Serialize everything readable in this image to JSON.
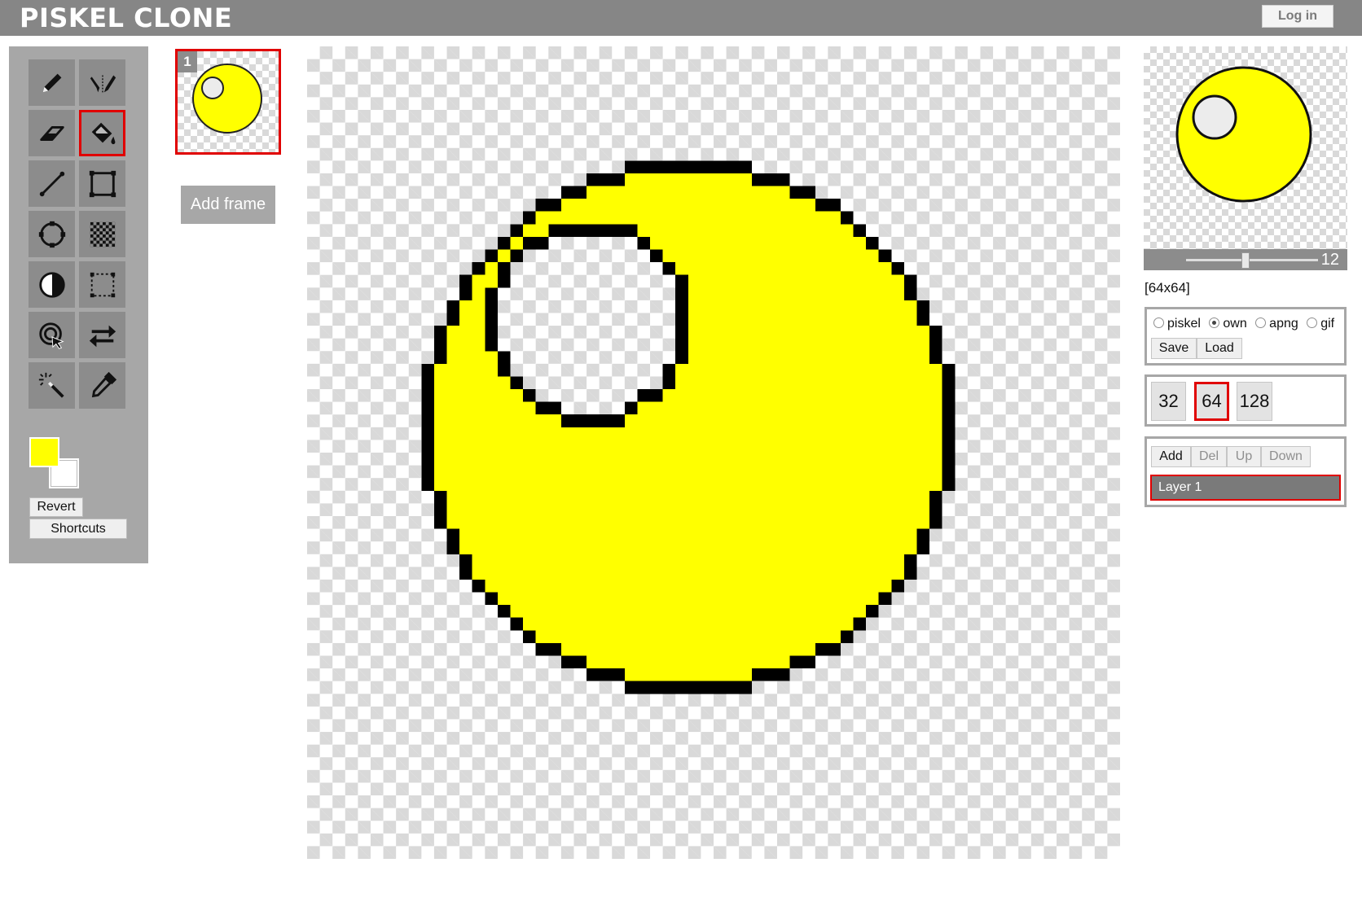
{
  "app": {
    "title": "PISKEL CLONE",
    "login_label": "Log in"
  },
  "tools": [
    {
      "name": "pen-tool",
      "icon": "pencil-icon",
      "selected": false
    },
    {
      "name": "mirror-pen-tool",
      "icon": "mirror-pen-icon",
      "selected": false
    },
    {
      "name": "eraser-tool",
      "icon": "eraser-icon",
      "selected": false
    },
    {
      "name": "paint-bucket-tool",
      "icon": "paint-bucket-icon",
      "selected": true
    },
    {
      "name": "stroke-tool",
      "icon": "line-icon",
      "selected": false
    },
    {
      "name": "rectangle-tool",
      "icon": "rectangle-icon",
      "selected": false
    },
    {
      "name": "circle-tool",
      "icon": "circle-icon",
      "selected": false
    },
    {
      "name": "dithering-tool",
      "icon": "checker-icon",
      "selected": false
    },
    {
      "name": "lighten-tool",
      "icon": "contrast-icon",
      "selected": false
    },
    {
      "name": "rectangle-select-tool",
      "icon": "dashed-rect-icon",
      "selected": false
    },
    {
      "name": "shape-select-tool",
      "icon": "lasso-icon",
      "selected": false
    },
    {
      "name": "move-tool",
      "icon": "swap-arrows-icon",
      "selected": false
    },
    {
      "name": "magic-wand-tool",
      "icon": "magic-wand-icon",
      "selected": false
    },
    {
      "name": "color-picker-tool",
      "icon": "eyedropper-icon",
      "selected": false
    }
  ],
  "colors": {
    "primary": "#ffff00",
    "secondary": "#ffffff",
    "accent": "#e00000",
    "panel": "#a7a7a7"
  },
  "buttons": {
    "revert": "Revert",
    "shortcuts": "Shortcuts"
  },
  "frames": {
    "items": [
      {
        "number": "1"
      }
    ],
    "add_label": "Add frame"
  },
  "preview": {
    "fps": "12",
    "fps_fraction": 0.45
  },
  "size_label": "[64x64]",
  "export": {
    "formats": [
      {
        "label": "piskel",
        "checked": false
      },
      {
        "label": "own",
        "checked": true
      },
      {
        "label": "apng",
        "checked": false
      },
      {
        "label": "gif",
        "checked": false
      }
    ],
    "save_label": "Save",
    "load_label": "Load"
  },
  "resolution": {
    "options": [
      "32",
      "64",
      "128"
    ],
    "selected": "64"
  },
  "layers": {
    "add_label": "Add",
    "del_label": "Del",
    "up_label": "Up",
    "down_label": "Down",
    "items": [
      {
        "name": "Layer 1",
        "selected": true
      }
    ]
  },
  "sprite": {
    "grid_size": 64
  }
}
